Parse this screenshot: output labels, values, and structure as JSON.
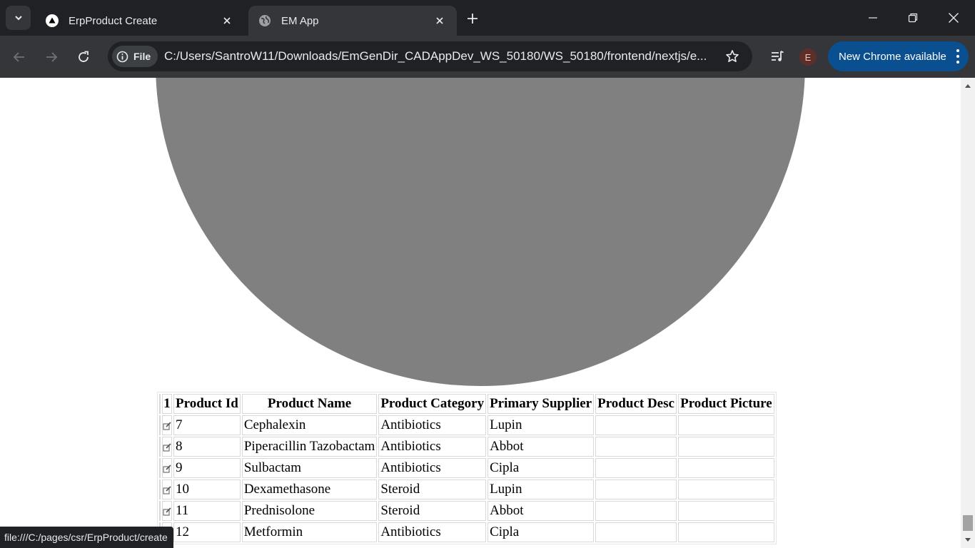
{
  "browser": {
    "tabs": [
      {
        "title": "ErpProduct Create",
        "favicon": "triangle-logo-icon",
        "active": false
      },
      {
        "title": "EM App",
        "favicon": "globe-icon",
        "active": true
      }
    ],
    "address_bar": {
      "site_info_label": "File",
      "url": "C:/Users/SantroW11/Downloads/EmGenDir_CADAppDev_WS_50180/WS_50180/frontend/nextjs/e..."
    },
    "profile_initial": "E",
    "update_button_label": "New Chrome available",
    "status_url": "file:///C:/pages/csr/ErpProduct/create"
  },
  "colors": {
    "placeholder_gray": "#808080",
    "update_button": "#0a4f8f"
  },
  "table": {
    "header_count": "1",
    "columns": [
      "Product Id",
      "Product Name",
      "Product Category",
      "Primary Supplier",
      "Product Desc",
      "Product Picture"
    ],
    "rows": [
      {
        "id": "7",
        "name": "Cephalexin",
        "category": "Antibiotics",
        "supplier": "Lupin",
        "desc": "",
        "picture": ""
      },
      {
        "id": "8",
        "name": "Piperacillin Tazobactam",
        "category": "Antibiotics",
        "supplier": "Abbot",
        "desc": "",
        "picture": ""
      },
      {
        "id": "9",
        "name": "Sulbactam",
        "category": "Antibiotics",
        "supplier": "Cipla",
        "desc": "",
        "picture": ""
      },
      {
        "id": "10",
        "name": "Dexamethasone",
        "category": "Steroid",
        "supplier": "Lupin",
        "desc": "",
        "picture": ""
      },
      {
        "id": "11",
        "name": "Prednisolone",
        "category": "Steroid",
        "supplier": "Abbot",
        "desc": "",
        "picture": ""
      },
      {
        "id": "12",
        "name": "Metformin",
        "category": "Antibiotics",
        "supplier": "Cipla",
        "desc": "",
        "picture": ""
      }
    ]
  }
}
